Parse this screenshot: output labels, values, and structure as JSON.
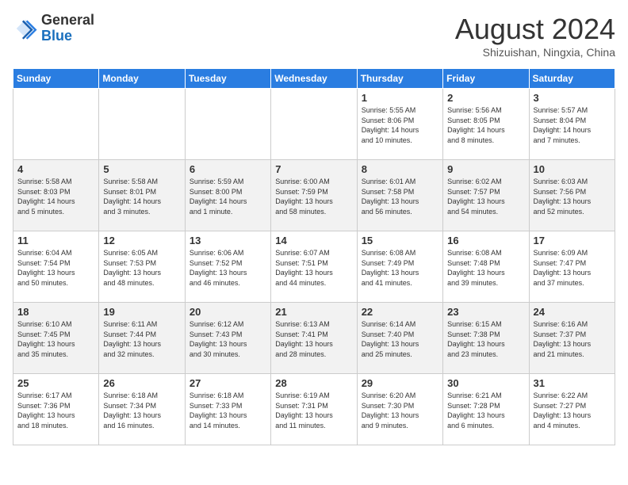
{
  "logo": {
    "general": "General",
    "blue": "Blue"
  },
  "title": "August 2024",
  "subtitle": "Shizuishan, Ningxia, China",
  "days_of_week": [
    "Sunday",
    "Monday",
    "Tuesday",
    "Wednesday",
    "Thursday",
    "Friday",
    "Saturday"
  ],
  "weeks": [
    [
      {
        "day": "",
        "info": ""
      },
      {
        "day": "",
        "info": ""
      },
      {
        "day": "",
        "info": ""
      },
      {
        "day": "",
        "info": ""
      },
      {
        "day": "1",
        "info": "Sunrise: 5:55 AM\nSunset: 8:06 PM\nDaylight: 14 hours\nand 10 minutes."
      },
      {
        "day": "2",
        "info": "Sunrise: 5:56 AM\nSunset: 8:05 PM\nDaylight: 14 hours\nand 8 minutes."
      },
      {
        "day": "3",
        "info": "Sunrise: 5:57 AM\nSunset: 8:04 PM\nDaylight: 14 hours\nand 7 minutes."
      }
    ],
    [
      {
        "day": "4",
        "info": "Sunrise: 5:58 AM\nSunset: 8:03 PM\nDaylight: 14 hours\nand 5 minutes."
      },
      {
        "day": "5",
        "info": "Sunrise: 5:58 AM\nSunset: 8:01 PM\nDaylight: 14 hours\nand 3 minutes."
      },
      {
        "day": "6",
        "info": "Sunrise: 5:59 AM\nSunset: 8:00 PM\nDaylight: 14 hours\nand 1 minute."
      },
      {
        "day": "7",
        "info": "Sunrise: 6:00 AM\nSunset: 7:59 PM\nDaylight: 13 hours\nand 58 minutes."
      },
      {
        "day": "8",
        "info": "Sunrise: 6:01 AM\nSunset: 7:58 PM\nDaylight: 13 hours\nand 56 minutes."
      },
      {
        "day": "9",
        "info": "Sunrise: 6:02 AM\nSunset: 7:57 PM\nDaylight: 13 hours\nand 54 minutes."
      },
      {
        "day": "10",
        "info": "Sunrise: 6:03 AM\nSunset: 7:56 PM\nDaylight: 13 hours\nand 52 minutes."
      }
    ],
    [
      {
        "day": "11",
        "info": "Sunrise: 6:04 AM\nSunset: 7:54 PM\nDaylight: 13 hours\nand 50 minutes."
      },
      {
        "day": "12",
        "info": "Sunrise: 6:05 AM\nSunset: 7:53 PM\nDaylight: 13 hours\nand 48 minutes."
      },
      {
        "day": "13",
        "info": "Sunrise: 6:06 AM\nSunset: 7:52 PM\nDaylight: 13 hours\nand 46 minutes."
      },
      {
        "day": "14",
        "info": "Sunrise: 6:07 AM\nSunset: 7:51 PM\nDaylight: 13 hours\nand 44 minutes."
      },
      {
        "day": "15",
        "info": "Sunrise: 6:08 AM\nSunset: 7:49 PM\nDaylight: 13 hours\nand 41 minutes."
      },
      {
        "day": "16",
        "info": "Sunrise: 6:08 AM\nSunset: 7:48 PM\nDaylight: 13 hours\nand 39 minutes."
      },
      {
        "day": "17",
        "info": "Sunrise: 6:09 AM\nSunset: 7:47 PM\nDaylight: 13 hours\nand 37 minutes."
      }
    ],
    [
      {
        "day": "18",
        "info": "Sunrise: 6:10 AM\nSunset: 7:45 PM\nDaylight: 13 hours\nand 35 minutes."
      },
      {
        "day": "19",
        "info": "Sunrise: 6:11 AM\nSunset: 7:44 PM\nDaylight: 13 hours\nand 32 minutes."
      },
      {
        "day": "20",
        "info": "Sunrise: 6:12 AM\nSunset: 7:43 PM\nDaylight: 13 hours\nand 30 minutes."
      },
      {
        "day": "21",
        "info": "Sunrise: 6:13 AM\nSunset: 7:41 PM\nDaylight: 13 hours\nand 28 minutes."
      },
      {
        "day": "22",
        "info": "Sunrise: 6:14 AM\nSunset: 7:40 PM\nDaylight: 13 hours\nand 25 minutes."
      },
      {
        "day": "23",
        "info": "Sunrise: 6:15 AM\nSunset: 7:38 PM\nDaylight: 13 hours\nand 23 minutes."
      },
      {
        "day": "24",
        "info": "Sunrise: 6:16 AM\nSunset: 7:37 PM\nDaylight: 13 hours\nand 21 minutes."
      }
    ],
    [
      {
        "day": "25",
        "info": "Sunrise: 6:17 AM\nSunset: 7:36 PM\nDaylight: 13 hours\nand 18 minutes."
      },
      {
        "day": "26",
        "info": "Sunrise: 6:18 AM\nSunset: 7:34 PM\nDaylight: 13 hours\nand 16 minutes."
      },
      {
        "day": "27",
        "info": "Sunrise: 6:18 AM\nSunset: 7:33 PM\nDaylight: 13 hours\nand 14 minutes."
      },
      {
        "day": "28",
        "info": "Sunrise: 6:19 AM\nSunset: 7:31 PM\nDaylight: 13 hours\nand 11 minutes."
      },
      {
        "day": "29",
        "info": "Sunrise: 6:20 AM\nSunset: 7:30 PM\nDaylight: 13 hours\nand 9 minutes."
      },
      {
        "day": "30",
        "info": "Sunrise: 6:21 AM\nSunset: 7:28 PM\nDaylight: 13 hours\nand 6 minutes."
      },
      {
        "day": "31",
        "info": "Sunrise: 6:22 AM\nSunset: 7:27 PM\nDaylight: 13 hours\nand 4 minutes."
      }
    ]
  ]
}
